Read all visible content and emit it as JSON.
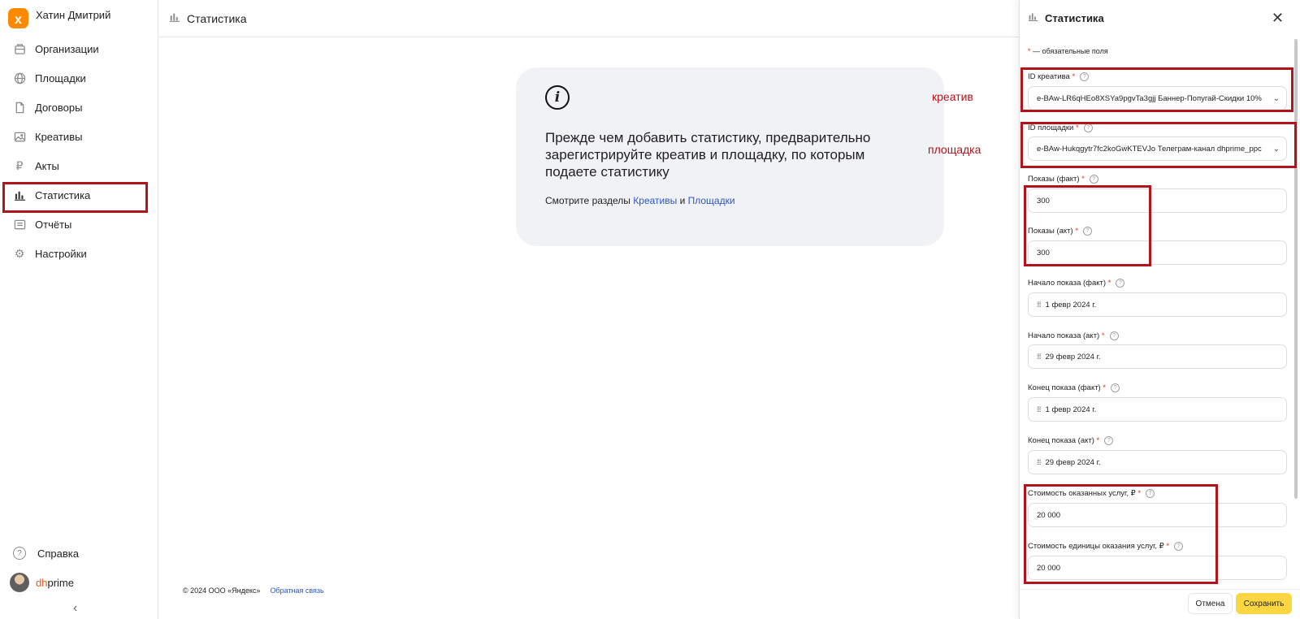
{
  "sidebar": {
    "user_name": "Хатин Дмитрий",
    "logo_letter": "x",
    "items": [
      {
        "label": "Организации",
        "icon": "building-icon"
      },
      {
        "label": "Площадки",
        "icon": "globe-icon"
      },
      {
        "label": "Договоры",
        "icon": "document-icon"
      },
      {
        "label": "Креативы",
        "icon": "image-icon"
      },
      {
        "label": "Акты",
        "icon": "ruble-icon"
      },
      {
        "label": "Статистика",
        "icon": "bar-chart-icon",
        "active": true
      },
      {
        "label": "Отчёты",
        "icon": "report-icon"
      },
      {
        "label": "Настройки",
        "icon": "gear-icon"
      }
    ],
    "help_label": "Справка",
    "account_name_prefix": "dh",
    "account_name_suffix": "prime"
  },
  "header": {
    "title": "Статистика"
  },
  "info": {
    "heading": "Прежде чем добавить статистику, предварительно зарегистрируйте креатив и площадку, по которым подаете статистику",
    "links_prefix": "Смотрите разделы",
    "link_creatives": "Креативы",
    "links_and": "и",
    "link_platforms": "Площадки"
  },
  "footer": {
    "copyright": "© 2024 ООО «Яндекс»",
    "feedback": "Обратная связь"
  },
  "annotations": {
    "creative": "креатив",
    "platform": "площадка"
  },
  "panel": {
    "title": "Статистика",
    "required_note": "— обязательные поля",
    "fields": [
      {
        "label": "ID креатива",
        "value": "e-BAw-LR6qHEo8XSYa9pgvTa3gjj Баннер-Попугай-Скидки 10%"
      },
      {
        "label": "ID площадки",
        "value": "e-BAw-Hukqgytr7fc2koGwKTEVJo Телеграм-канал dhprime_ppc"
      },
      {
        "label": "Показы (факт)",
        "value": "300"
      },
      {
        "label": "Показы (акт)",
        "value": "300"
      },
      {
        "label": "Начало показа (факт)",
        "value": "1 февр 2024 г."
      },
      {
        "label": "Начало показа (акт)",
        "value": "29 февр 2024 г."
      },
      {
        "label": "Конец показа (факт)",
        "value": "1 февр 2024 г."
      },
      {
        "label": "Конец показа (акт)",
        "value": "29 февр 2024 г."
      },
      {
        "label": "Стоимость оказанных услуг, ₽",
        "value": "20 000"
      },
      {
        "label": "Стоимость единицы оказания услуг, ₽",
        "value": "20 000"
      }
    ],
    "cancel_label": "Отмена",
    "save_label": "Сохранить"
  },
  "colors": {
    "accent_yellow": "#fcd640",
    "logo_orange": "#fc8a00",
    "annotation_red": "#b3131b",
    "link_blue": "#2b56c7"
  }
}
